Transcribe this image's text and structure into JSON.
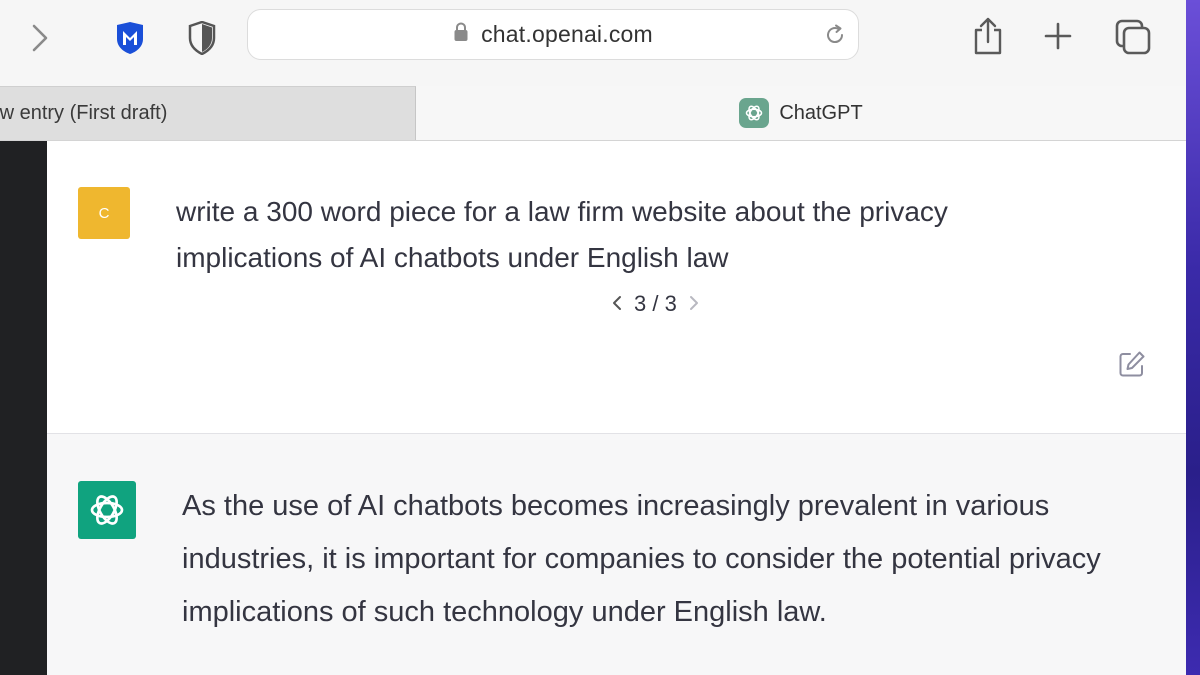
{
  "browser": {
    "forward_icon": "chevron-right-icon",
    "extension_1_icon": "mcafee-shield-icon",
    "extension_2_icon": "privacy-shield-icon",
    "url": "chat.openai.com",
    "lock_icon": "lock-icon",
    "reload_icon": "reload-icon",
    "share_icon": "share-icon",
    "new_tab_icon": "plus-icon",
    "tab_overview_icon": "tab-overview-icon"
  },
  "tabs": [
    {
      "label": "New entry (First draft)",
      "active": false
    },
    {
      "label": "ChatGPT",
      "active": true
    }
  ],
  "conversation": {
    "user": {
      "avatar_initial": "C",
      "avatar_color": "#efb72f",
      "message": "write a 300 word piece for a law firm website about the privacy implications of AI chatbots under English law",
      "pager": "3 / 3",
      "edit_icon": "edit-icon"
    },
    "assistant": {
      "avatar_color": "#10a37f",
      "avatar_icon": "openai-logo-icon",
      "message": "As the use of AI chatbots becomes increasingly prevalent in various industries, it is important for companies to consider the potential privacy implications of such technology under English law."
    }
  }
}
